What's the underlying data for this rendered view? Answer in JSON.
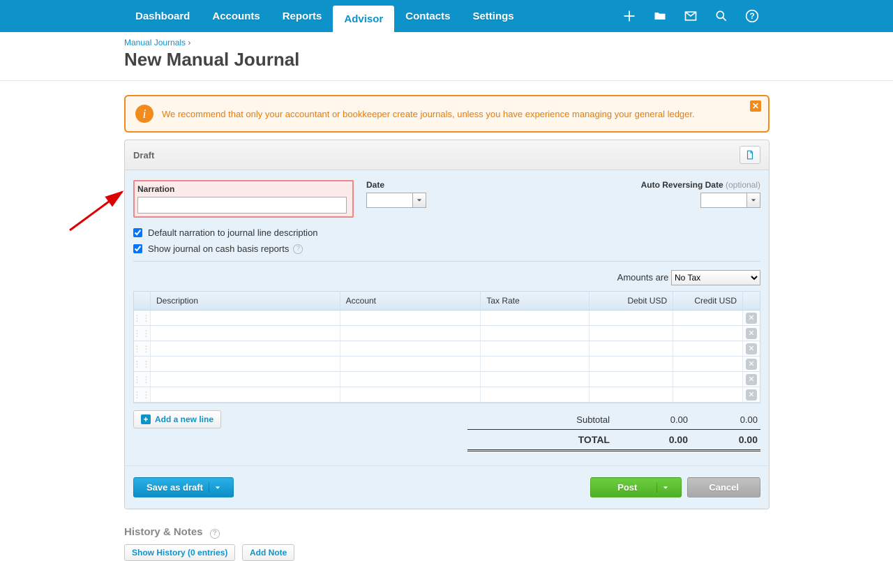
{
  "nav": {
    "items": [
      "Dashboard",
      "Accounts",
      "Reports",
      "Advisor",
      "Contacts",
      "Settings"
    ],
    "active_index": 3
  },
  "breadcrumb": {
    "link": "Manual Journals",
    "sep": "›"
  },
  "page_title": "New Manual Journal",
  "banner": {
    "text": "We recommend that only your accountant or bookkeeper create journals, unless you have experience managing your general ledger."
  },
  "panel": {
    "status": "Draft",
    "fields": {
      "narration_label": "Narration",
      "narration_value": "",
      "date_label": "Date",
      "date_value": "",
      "reversing_label": "Auto Reversing Date",
      "reversing_optional": "(optional)",
      "reversing_value": ""
    },
    "checks": {
      "default_narration_label": "Default narration to journal line description",
      "default_narration_checked": true,
      "show_cash_label": "Show journal on cash basis reports",
      "show_cash_checked": true
    },
    "amounts": {
      "label": "Amounts are",
      "selected": "No Tax"
    },
    "grid": {
      "headers": {
        "description": "Description",
        "account": "Account",
        "tax": "Tax Rate",
        "debit": "Debit USD",
        "credit": "Credit USD"
      },
      "rows": 6
    },
    "add_line_label": "Add a new line",
    "totals": {
      "subtotal_label": "Subtotal",
      "subtotal_debit": "0.00",
      "subtotal_credit": "0.00",
      "total_label": "TOTAL",
      "total_debit": "0.00",
      "total_credit": "0.00"
    },
    "buttons": {
      "save_draft": "Save as draft",
      "post": "Post",
      "cancel": "Cancel"
    }
  },
  "history": {
    "title": "History & Notes",
    "show_history": "Show History (0 entries)",
    "add_note": "Add Note"
  }
}
